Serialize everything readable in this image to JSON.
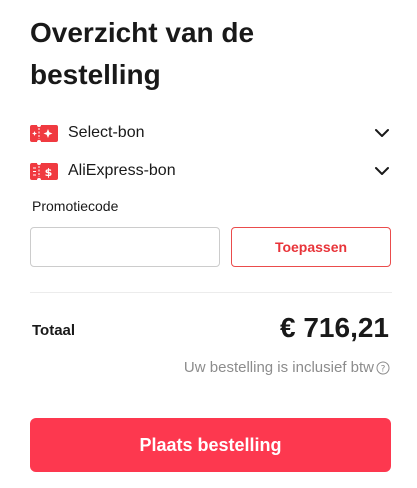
{
  "summary": {
    "title": "Overzicht van de bestelling"
  },
  "coupons": [
    {
      "label": "Select-bon",
      "icon": "select-coupon-icon",
      "expand_icon": "chevron-down-icon"
    },
    {
      "label": "AliExpress-bon",
      "icon": "aliexpress-coupon-icon",
      "expand_icon": "chevron-down-icon"
    }
  ],
  "promo": {
    "label": "Promotiecode",
    "value": "",
    "placeholder": "",
    "apply_label": "Toepassen"
  },
  "total": {
    "label": "Totaal",
    "value": "€ 716,21",
    "vat_note": "Uw bestelling is inclusief btw",
    "vat_icon": "question-circle-icon"
  },
  "actions": {
    "place_order_label": "Plaats bestelling"
  },
  "colors": {
    "accent": "#fd384f",
    "coupon_icon": "#f03a40",
    "apply_border": "#ea4c4c",
    "muted_text": "#8c8c8c"
  }
}
